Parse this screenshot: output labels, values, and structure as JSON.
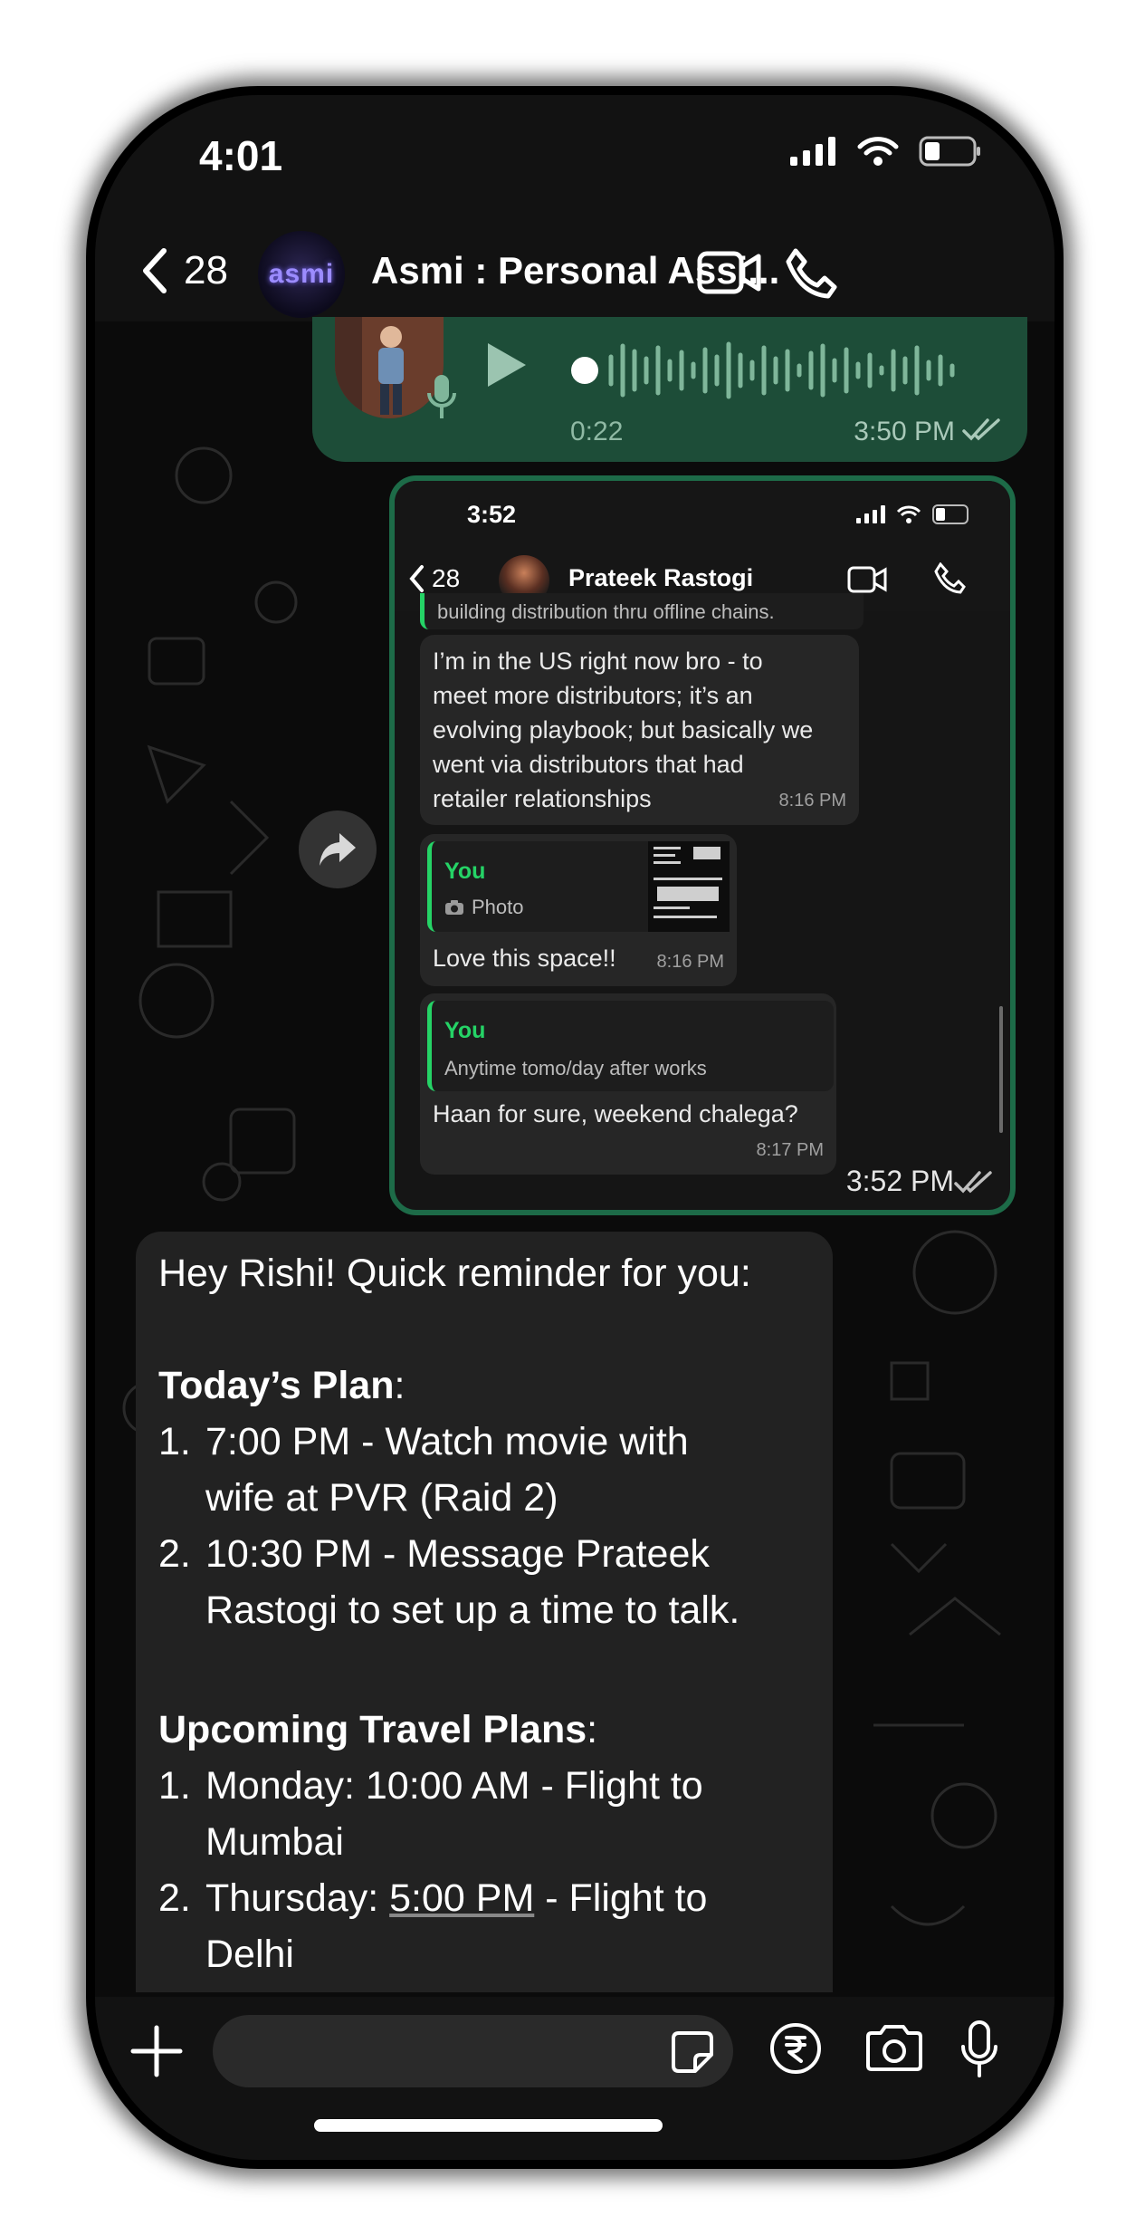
{
  "status_bar": {
    "time": "4:01"
  },
  "header": {
    "back_count": "28",
    "avatar_text": "asmi",
    "title": "Asmi : Personal Assi..."
  },
  "voice_message": {
    "duration": "0:22",
    "time": "3:50 PM"
  },
  "screenshot": {
    "time": "3:52",
    "back_count": "28",
    "contact": "Prateek Rastogi",
    "partial_line": "building distribution thru offline chains.",
    "msg1": {
      "lines": [
        "I’m in the US right now bro - to",
        "meet more distributors; it’s an",
        "evolving playbook; but basically we",
        "went via distributors that had",
        "retailer relationships"
      ],
      "time": "8:16 PM"
    },
    "msg2": {
      "quote_author": "You",
      "quote_text": "Photo",
      "text": "Love this space!!",
      "time": "8:16 PM"
    },
    "msg3": {
      "quote_author": "You",
      "quote_text": "Anytime tomo/day after works",
      "text": "Haan for sure, weekend chalega?",
      "time": "8:17 PM"
    }
  },
  "screenshot_bubble_time": "3:52 PM",
  "reminder": {
    "greeting": "Hey Rishi! Quick reminder for you:",
    "today_heading": "Today’s Plan",
    "today_items": [
      {
        "num": "1.",
        "lines": [
          "7:00 PM - Watch movie with",
          "wife at PVR (Raid 2)"
        ]
      },
      {
        "num": "2.",
        "lines": [
          "10:30 PM - Message Prateek",
          "Rastogi to set up a time to talk."
        ]
      }
    ],
    "travel_heading": "Upcoming Travel Plans",
    "travel_items": [
      {
        "num": "1.",
        "lines": [
          "Monday: 10:00 AM - Flight to",
          "Mumbai"
        ]
      },
      {
        "num": "2.",
        "line1_pre": "Thursday: ",
        "line1_link": "5:00 PM",
        "line1_post": " - Flight to",
        "line2": "Delhi"
      }
    ]
  },
  "colors": {
    "accent_green": "#25d366",
    "outgoing_bubble": "#1d4d38",
    "incoming_bubble": "#222222"
  }
}
